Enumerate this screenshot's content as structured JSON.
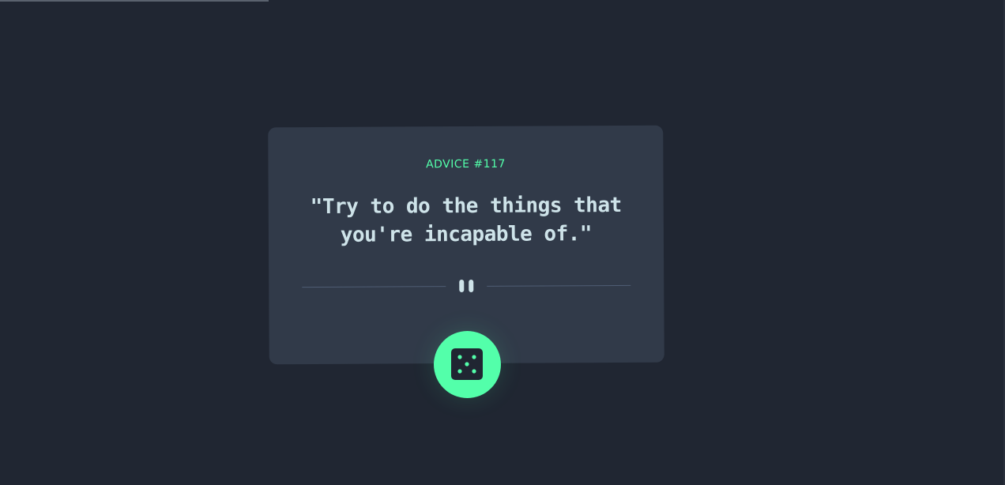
{
  "advice": {
    "id_label": "ADVICE #117",
    "text": "\"Try to do the things that you're incapable of.\""
  },
  "controls": {
    "dice_icon": "dice-icon",
    "divider_icon": "pause-icon"
  },
  "colors": {
    "background": "#202632",
    "card": "#313a49",
    "accent": "#53ffaa",
    "text": "#cee3e9"
  }
}
